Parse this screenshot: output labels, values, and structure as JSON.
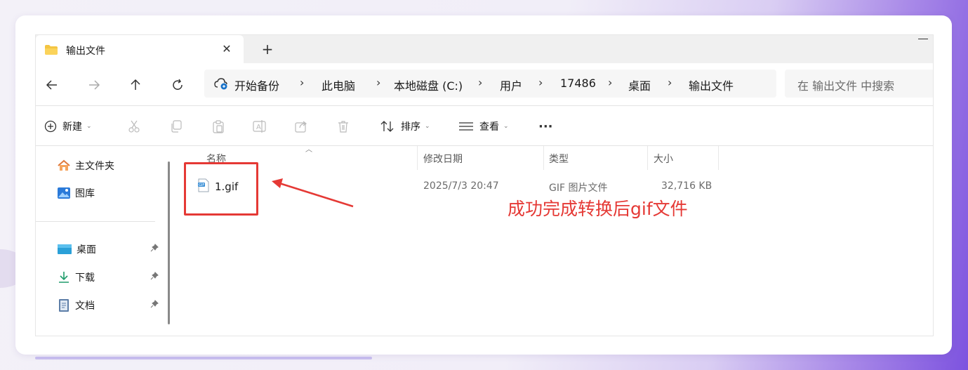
{
  "window": {
    "tab_title": "输出文件",
    "close_glyph": "✕",
    "new_tab_glyph": "+"
  },
  "nav": {
    "back_icon": "arrow-left",
    "forward_icon": "arrow-right",
    "up_icon": "arrow-up",
    "refresh_icon": "refresh",
    "breadcrumbs": [
      "开始备份",
      "此电脑",
      "本地磁盘 (C:)",
      "用户",
      "17486",
      "桌面",
      "输出文件"
    ],
    "separator": "›",
    "search_placeholder": "在 输出文件 中搜索"
  },
  "toolbar": {
    "new_label": "新建",
    "sort_label": "排序",
    "view_label": "查看",
    "more_label": "···",
    "chevron": "⌄"
  },
  "sidebar": {
    "items": [
      {
        "label": "主文件夹",
        "icon": "home-icon"
      },
      {
        "label": "图库",
        "icon": "gallery-icon"
      },
      {
        "label": "桌面",
        "icon": "desktop-icon",
        "pinned": true
      },
      {
        "label": "下载",
        "icon": "download-icon",
        "pinned": true
      },
      {
        "label": "文档",
        "icon": "document-icon",
        "pinned": true
      }
    ],
    "pin_glyph": "📌"
  },
  "columns": {
    "name": "名称",
    "modified": "修改日期",
    "type": "类型",
    "size": "大小"
  },
  "files": [
    {
      "name": "1.gif",
      "modified": "2025/7/3 20:47",
      "type": "GIF 图片文件",
      "size": "32,716 KB"
    }
  ],
  "annotation": {
    "text": "成功完成转换后gif文件",
    "color": "#e53935"
  },
  "colors": {
    "accent": "#7d53df",
    "annotation": "#e53935"
  }
}
